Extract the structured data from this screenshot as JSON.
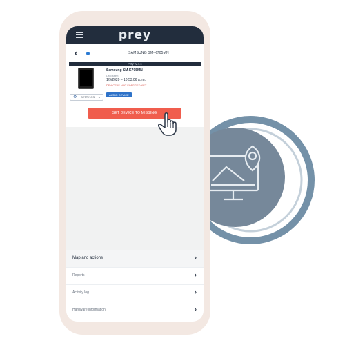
{
  "app": {
    "logo_text": "prey"
  },
  "header": {
    "device_name": "SAMSUNG SM-K705MN"
  },
  "banner": {
    "text": "Prey v2.4.4"
  },
  "device": {
    "model": "Samsung SM-K705MN",
    "last_seen_label": "Last seen:",
    "last_seen_date": "1/9/2020 – 10:53:06 a. m.",
    "status": "DEVICE IS NOT FLAGGED YET",
    "audio_button": "AUDIO DEVICE"
  },
  "settings": {
    "label": "SETTINGS"
  },
  "action": {
    "set_missing_label": "SET DEVICE TO MISSING"
  },
  "menu": {
    "items": [
      {
        "label": "Map and actions"
      },
      {
        "label": "Reports"
      },
      {
        "label": "Activity log"
      },
      {
        "label": "Hardware information"
      }
    ]
  },
  "icons": [
    "menu-icon",
    "back-arrow-icon",
    "status-dot-icon",
    "gear-icon",
    "chevron-down-icon",
    "hand-cursor-icon",
    "chevron-right-icon",
    "device-location-icon"
  ],
  "colors": {
    "primary_dark": "#222d3d",
    "accent_red": "#f05d4d",
    "accent_blue": "#2f73c9",
    "phone_frame": "#f3e8e2",
    "deco_circle": "#6f8ca3"
  }
}
